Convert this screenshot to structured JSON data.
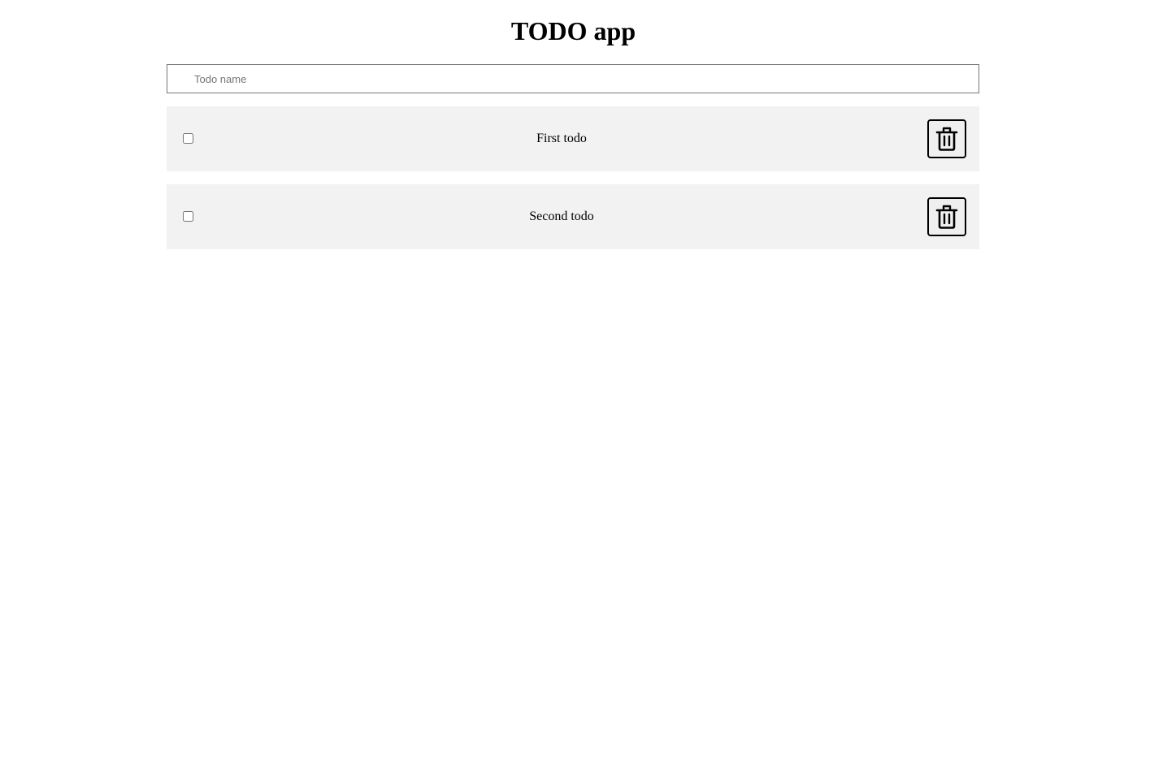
{
  "header": {
    "title": "TODO app"
  },
  "new_todo": {
    "placeholder": "Todo name",
    "value": ""
  },
  "todos": [
    {
      "label": "First todo",
      "completed": false,
      "delete_icon": "trash-icon"
    },
    {
      "label": "Second todo",
      "completed": false,
      "delete_icon": "trash-icon"
    }
  ],
  "colors": {
    "item_background": "#f2f2f2",
    "input_border": "#767676",
    "button_border": "#000000"
  }
}
